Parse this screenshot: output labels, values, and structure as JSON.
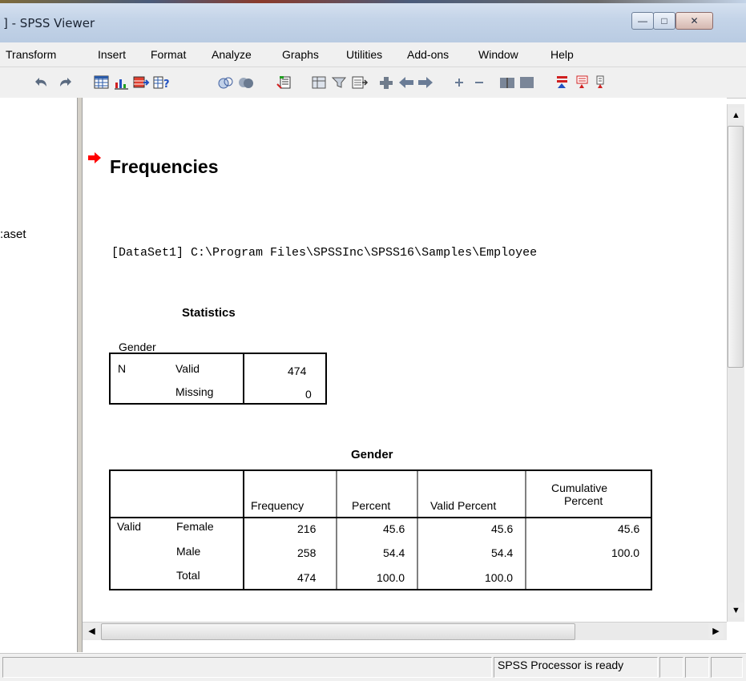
{
  "window": {
    "title": "] - SPSS Viewer",
    "controls": {
      "minimize": "—",
      "maximize": "□",
      "close": "✕"
    }
  },
  "menu": [
    "Transform",
    "Insert",
    "Format",
    "Analyze",
    "Graphs",
    "Utilities",
    "Add-ons",
    "Window",
    "Help"
  ],
  "toolbar": {
    "icons": [
      "undo-icon",
      "redo-icon",
      "go-to-data-icon",
      "chart-builder-icon",
      "insert-variable-icon",
      "variable-info-icon",
      "use-sets-icon",
      "show-all-icon",
      "designate-window-icon",
      "pivot-table-icon",
      "value-labels-icon",
      "insert-output-icon",
      "promote-icon",
      "back-arrow-icon",
      "forward-arrow-icon",
      "expand-icon",
      "collapse-icon",
      "show-icon",
      "hide-icon",
      "insert-heading-icon",
      "insert-title-icon",
      "insert-text-icon"
    ]
  },
  "outline": {
    "visible_label": ":aset"
  },
  "output": {
    "heading": "Frequencies",
    "dataset_line": "[DataSet1] C:\\Program Files\\SPSSInc\\SPSS16\\Samples\\Employee",
    "statistics": {
      "title": "Statistics",
      "variable": "Gender",
      "rows": [
        {
          "group": "N",
          "label": "Valid",
          "value": "474"
        },
        {
          "group": "",
          "label": "Missing",
          "value": "0"
        }
      ]
    },
    "gender_table": {
      "title": "Gender",
      "columns": [
        "Frequency",
        "Percent",
        "Valid Percent",
        "Cumulative",
        "Percent"
      ],
      "rows": [
        {
          "group": "Valid",
          "label": "Female",
          "frequency": "216",
          "percent": "45.6",
          "valid_percent": "45.6",
          "cumulative": "45.6"
        },
        {
          "group": "",
          "label": "Male",
          "frequency": "258",
          "percent": "54.4",
          "valid_percent": "54.4",
          "cumulative": "100.0"
        },
        {
          "group": "",
          "label": "Total",
          "frequency": "474",
          "percent": "100.0",
          "valid_percent": "100.0",
          "cumulative": ""
        }
      ]
    }
  },
  "status": {
    "text": "SPSS  Processor is ready"
  },
  "colors": {
    "arrow": "#ff0000",
    "title_bar": "#c4d4e8",
    "chrome": "#f0f0f0"
  }
}
